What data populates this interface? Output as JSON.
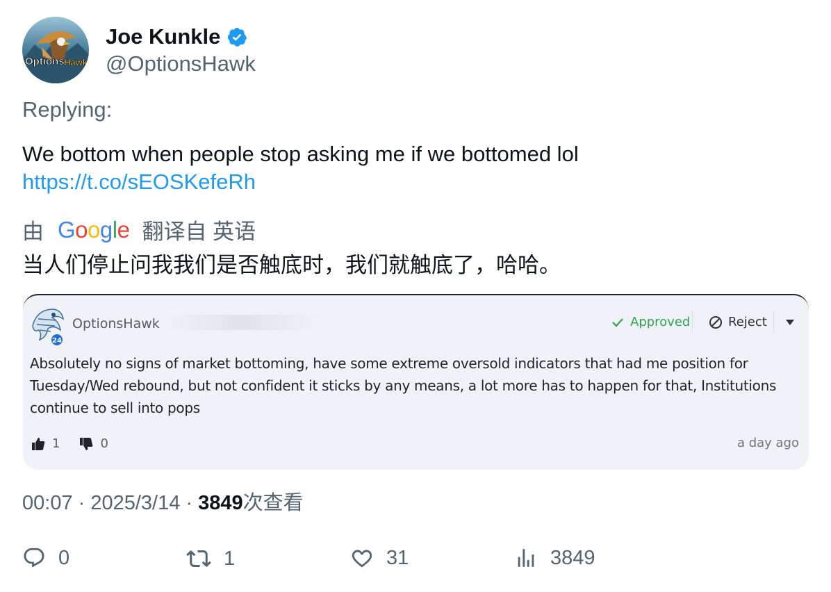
{
  "user": {
    "display_name": "Joe Kunkle",
    "handle": "@OptionsHawk",
    "avatar_text_a": "Options",
    "avatar_text_b": "Hawk",
    "verified_icon": "verified-badge-icon"
  },
  "tweet": {
    "replying": "Replying:",
    "text": "We bottom when people stop asking me if we bottomed lol",
    "link": "https://t.co/sEOSKefeRh"
  },
  "translation": {
    "prefix": "由",
    "provider": "Google",
    "suffix": "翻译自 英语",
    "text": "当人们停止问我我们是否触底时，我们就触底了，哈哈。"
  },
  "embedded_card": {
    "username": "OptionsHawk",
    "badge": "24",
    "approve_label": "Approved",
    "reject_label": "Reject",
    "body": "Absolutely no signs of market bottoming, have some extreme oversold indicators that had me position for Tuesday/Wed rebound, but not confident it sticks by any means, a lot more has to happen for that, Institutions continue to sell into pops",
    "upvotes": "1",
    "downvotes": "0",
    "time": "a day ago",
    "colors": {
      "approve": "#2ea44f",
      "background": "#f0f2f7"
    }
  },
  "meta": {
    "time": "00:07",
    "date": "2025/3/14",
    "views": "3849",
    "views_label": "次查看"
  },
  "actions": {
    "replies": "0",
    "retweets": "1",
    "likes": "31",
    "views": "3849"
  },
  "colors": {
    "link": "#1d9bf0",
    "muted": "#536471",
    "text": "#0f1419"
  }
}
